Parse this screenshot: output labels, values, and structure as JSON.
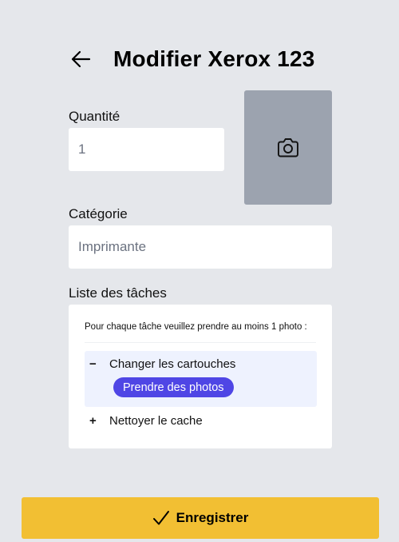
{
  "header": {
    "title": "Modifier Xerox 123",
    "back_icon": "arrow-left-icon"
  },
  "form": {
    "quantity_label": "Quantité",
    "quantity_value": "1",
    "category_label": "Catégorie",
    "category_value": "Imprimante",
    "photo_icon": "camera-icon"
  },
  "tasks": {
    "label": "Liste des tâches",
    "note": "Pour chaque tâche veuillez prendre au moins 1 photo :",
    "items": [
      {
        "sign": "−",
        "label": "Changer les cartouches",
        "expanded": true,
        "action_label": "Prendre des photos"
      },
      {
        "sign": "+",
        "label": "Nettoyer le cache",
        "expanded": false
      }
    ]
  },
  "footer": {
    "save_label": "Enregistrer",
    "save_icon": "check-icon"
  },
  "colors": {
    "background": "#e5e7eb",
    "accent": "#f2bf33",
    "primary_button": "#4f46e5",
    "photo_placeholder": "#9ca3af",
    "task_highlight": "#eef2fe"
  }
}
